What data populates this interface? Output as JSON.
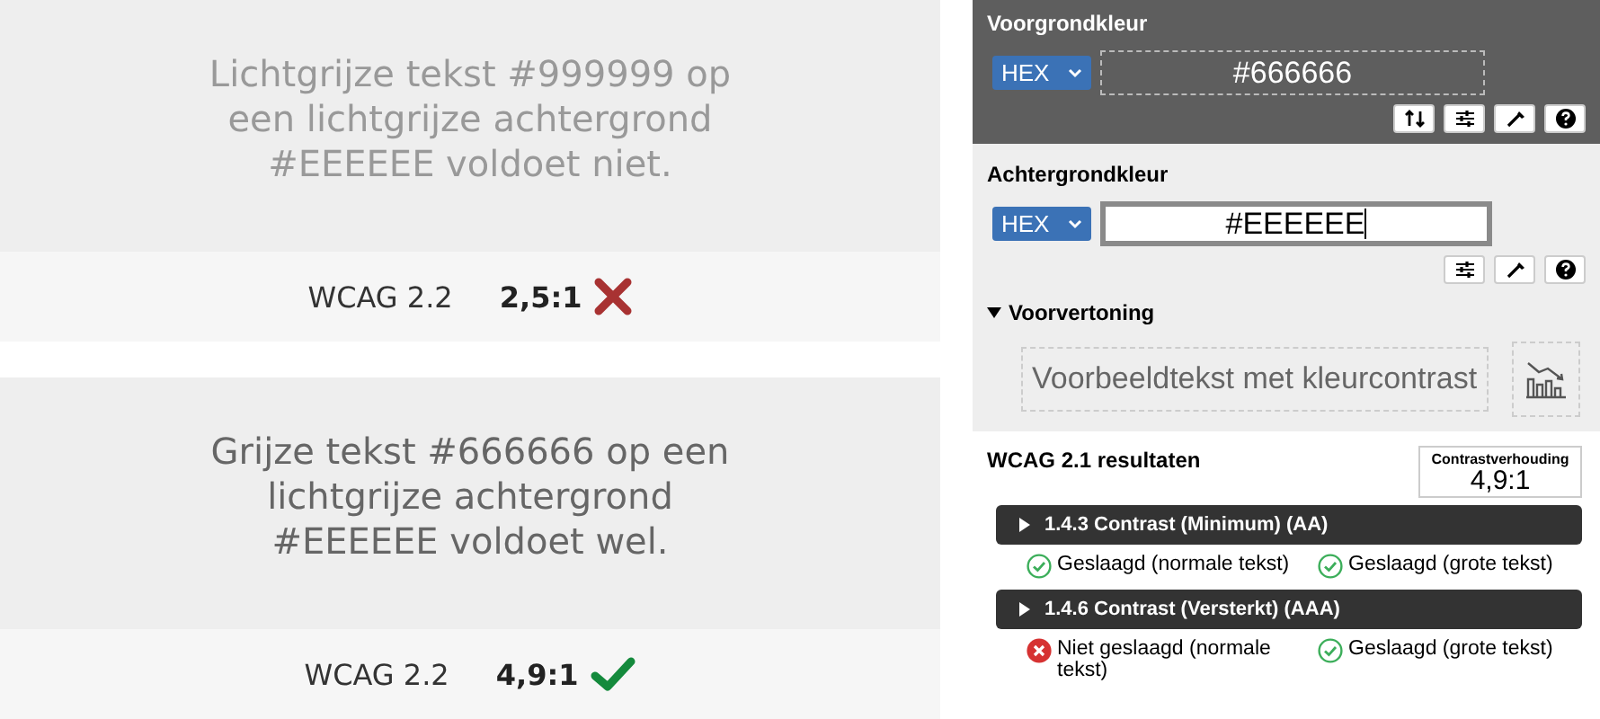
{
  "examples": [
    {
      "text": "Lichtgrijze tekst #999999 op een lichtgrijze achtergrond #EEEEEE voldoet niet.",
      "color": "#999999",
      "standard": "WCAG 2.2",
      "ratio": "2,5:1",
      "passed": false
    },
    {
      "text": "Grijze tekst #666666 op een lichtgrijze achtergrond #EEEEEE voldoet wel.",
      "color": "#666666",
      "standard": "WCAG 2.2",
      "ratio": "4,9:1",
      "passed": true
    }
  ],
  "checker": {
    "foreground": {
      "label": "Voorgrondkleur",
      "format": "HEX",
      "value": "#666666",
      "focused": false
    },
    "background": {
      "label": "Achtergrondkleur",
      "format": "HEX",
      "value": "#EEEEEE",
      "focused": true
    },
    "preview": {
      "label": "Voorvertoning",
      "expanded": true,
      "sample": "Voorbeeldtekst met kleurcontrast"
    },
    "results": {
      "title": "WCAG 2.1 resultaten",
      "ratio_label": "Contrastverhouding",
      "ratio": "4,9:1",
      "criteria": [
        {
          "title": "1.4.3 Contrast (Minimum) (AA)",
          "expanded": false,
          "outcomes": [
            {
              "text": "Geslaagd (normale tekst)",
              "passed": true
            },
            {
              "text": "Geslaagd (grote tekst)",
              "passed": true
            }
          ]
        },
        {
          "title": "1.4.6 Contrast (Versterkt) (AAA)",
          "expanded": false,
          "outcomes": [
            {
              "text": "Niet geslaagd (normale tekst)",
              "passed": false
            },
            {
              "text": "Geslaagd (grote tekst)",
              "passed": true
            }
          ]
        }
      ]
    }
  }
}
